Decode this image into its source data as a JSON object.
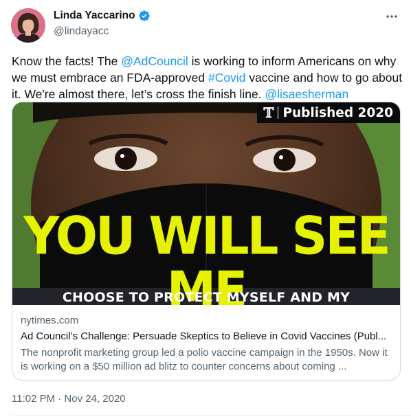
{
  "author": {
    "display_name": "Linda Yaccarino",
    "handle": "@lindayacc",
    "verified": true
  },
  "tweet": {
    "text_parts": {
      "p0": "Know the facts! The ",
      "m1": "@AdCouncil",
      "p1": " is working to inform Americans on why we must embrace an FDA-approved ",
      "h1": "#Covid",
      "p2": " vaccine and how to go about it. We're almost there, let’s cross the finish line. ",
      "m2": "@lisaesherman"
    },
    "timestamp": "11:02 PM · Nov 24, 2020"
  },
  "card": {
    "badge_text": "Published 2020",
    "badge_logo": "𝕋",
    "headline_overlay": "YOU WILL SEE ME",
    "subline_overlay": "CHOOSE TO PROTECT MYSELF AND MY",
    "domain": "nytimes.com",
    "title": "Ad Council’s Challenge: Persuade Skeptics to Believe in Covid Vaccines (Publ...",
    "description": "The nonprofit marketing group led a polio vaccine campaign in the 1950s. Now it is working on a $50 million ad blitz to counter concerns about coming ..."
  },
  "colors": {
    "link": "#1d9bf0",
    "verified": "#1d9bf0",
    "overlay_text": "#e5f200"
  },
  "icons": {
    "more": "more-horizontal-icon",
    "verified": "verified-badge-icon"
  }
}
